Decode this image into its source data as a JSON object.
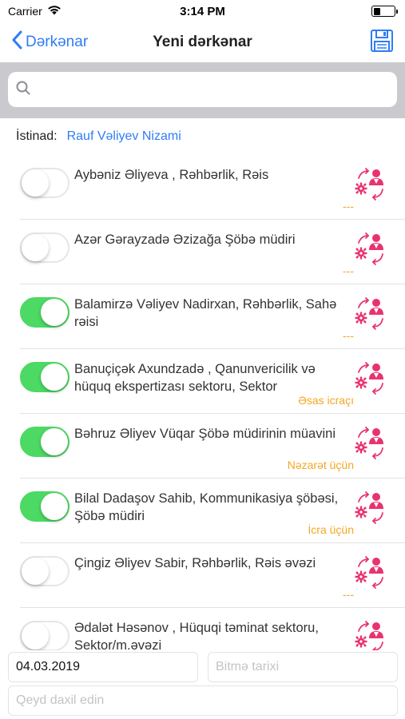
{
  "status_bar": {
    "carrier": "Carrier",
    "time": "3:14 PM",
    "battery_level": 0.35
  },
  "nav": {
    "back_label": "Dərkənar",
    "title": "Yeni dərkənar",
    "save_icon": "floppy-disk-icon"
  },
  "search": {
    "placeholder": "",
    "value": ""
  },
  "istinad": {
    "label": "İstinad:",
    "value": "Rauf  Vəliyev Nizami"
  },
  "colors": {
    "accent": "#2f7cf6",
    "switch_on": "#4cd964",
    "role_text": "#f5a623",
    "action_icon": "#e8336f",
    "search_bg": "#c9c9ce"
  },
  "employees": [
    {
      "name": "Aybəniz Əliyeva , Rəhbərlik, Rəis",
      "on": false,
      "role": "---"
    },
    {
      "name": "Azər Gərayzadə Əzizağa Şöbə müdiri",
      "on": false,
      "role": "---"
    },
    {
      "name": "Balamirzə Vəliyev Nadirxan, Rəhbərlik, Sahə rəisi",
      "on": true,
      "role": "---"
    },
    {
      "name": "Banuçiçək Axundzadə , Qanunvericilik və hüquq ekspertizası sektoru, Sektor",
      "on": true,
      "role": "Əsas icraçı"
    },
    {
      "name": "Bəhruz Əliyev Vüqar Şöbə müdirinin müavini",
      "on": true,
      "role": "Nəzarət üçün"
    },
    {
      "name": "Bilal Dadaşov Sahib, Kommunikasiya şöbəsi, Şöbə müdiri",
      "on": true,
      "role": "İcra üçün"
    },
    {
      "name": "Çingiz Əliyev Sabir, Rəhbərlik, Rəis əvəzi",
      "on": false,
      "role": "---"
    },
    {
      "name": "Ədalət Həsənov , Hüquqi təminat sektoru, Sektor/m.əvəzi",
      "on": false,
      "role": ""
    }
  ],
  "form": {
    "start_date": "04.03.2019",
    "end_date_placeholder": "Bitmə tarixi",
    "note_placeholder": "Qeyd daxil edin"
  }
}
